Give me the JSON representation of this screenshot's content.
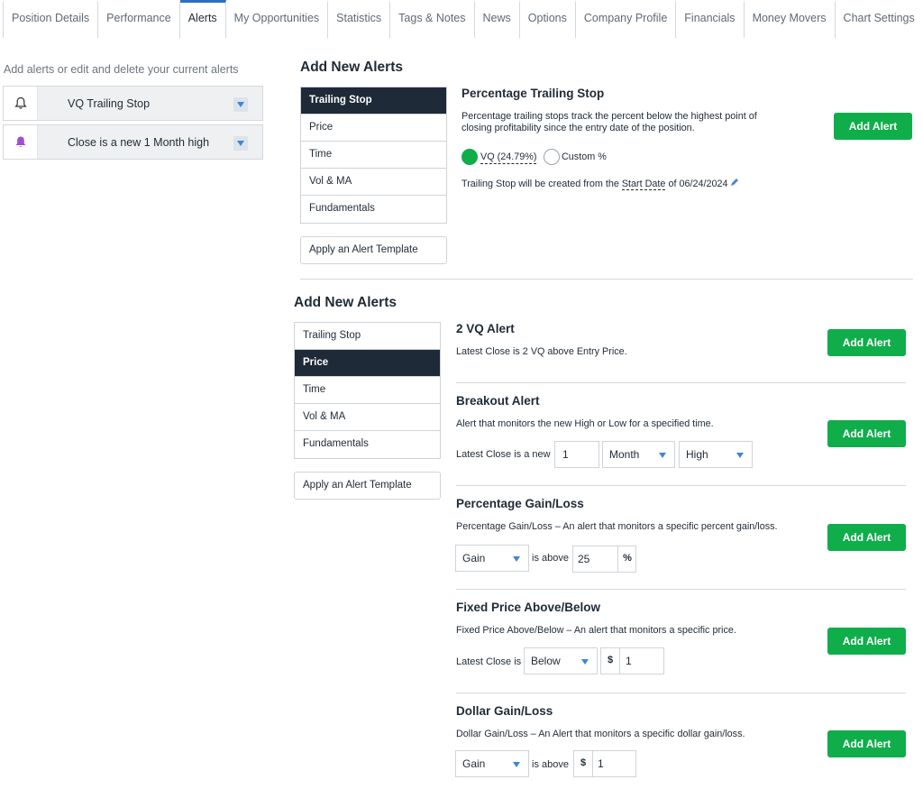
{
  "tabs": [
    {
      "label": "Position Details"
    },
    {
      "label": "Performance"
    },
    {
      "label": "Alerts"
    },
    {
      "label": "My Opportunities"
    },
    {
      "label": "Statistics"
    },
    {
      "label": "Tags & Notes"
    },
    {
      "label": "News"
    },
    {
      "label": "Options"
    },
    {
      "label": "Company Profile"
    },
    {
      "label": "Financials"
    },
    {
      "label": "Money Movers"
    },
    {
      "label": "Chart Settings"
    }
  ],
  "active_tab": "Alerts",
  "current_alerts": {
    "heading": "Add alerts or edit and delete your current alerts",
    "items": [
      {
        "label": "VQ Trailing Stop",
        "icon": "bell-outline-icon"
      },
      {
        "label": "Close is a new 1 Month high",
        "icon": "bell-filled-purple-icon",
        "color": "#a34bd6"
      }
    ]
  },
  "panel1": {
    "title": "Add New Alerts",
    "menu": [
      "Trailing Stop",
      "Price",
      "Time",
      "Vol & MA",
      "Fundamentals"
    ],
    "selected": "Trailing Stop",
    "template_label": "Apply an Alert Template",
    "pts": {
      "title": "Percentage Trailing Stop",
      "desc_line1": "Percentage trailing stops track the percent below the highest point of",
      "desc_line2": "closing profitability since the entry date of the position.",
      "option_vq": "VQ (24.79%)",
      "option_custom": "Custom %",
      "start_prefix": "Trailing Stop will be created from the",
      "start_link": "Start Date",
      "start_suffix": "of 06/24/2024",
      "button": "Add Alert"
    }
  },
  "panel2": {
    "title": "Add New Alerts",
    "menu": [
      "Trailing Stop",
      "Price",
      "Time",
      "Vol & MA",
      "Fundamentals"
    ],
    "selected": "Price",
    "template_label": "Apply an Alert Template",
    "alerts": {
      "vq2": {
        "title": "2 VQ Alert",
        "desc": "Latest Close is 2 VQ above Entry Price.",
        "button": "Add Alert"
      },
      "breakout": {
        "title": "Breakout Alert",
        "desc": "Alert that monitors the new High or Low for a specified time.",
        "label": "Latest Close is a new",
        "number": "1",
        "period": "Month",
        "hilo": "High",
        "button": "Add Alert"
      },
      "pct": {
        "title": "Percentage Gain/Loss",
        "desc": "Percentage Gain/Loss – An alert that monitors a specific percent gain/loss.",
        "direction": "Gain",
        "mid_label": "is above",
        "value": "25",
        "unit": "%",
        "button": "Add Alert"
      },
      "fixed": {
        "title": "Fixed Price Above/Below",
        "desc": "Fixed Price Above/Below – An alert that monitors a specific price.",
        "label": "Latest Close is",
        "direction": "Below",
        "currency": "$",
        "value": "1",
        "button": "Add Alert"
      },
      "dollar": {
        "title": "Dollar Gain/Loss",
        "desc": "Dollar Gain/Loss – An Alert that monitors a specific dollar gain/loss.",
        "direction": "Gain",
        "mid_label": "is above",
        "currency": "$",
        "value": "1",
        "button": "Add Alert"
      }
    }
  },
  "colors": {
    "accent_green": "#0fae4a",
    "nav_dark": "#1e2a38",
    "active_tab": "#2f6fc2",
    "caret_blue": "#3d86d6"
  }
}
